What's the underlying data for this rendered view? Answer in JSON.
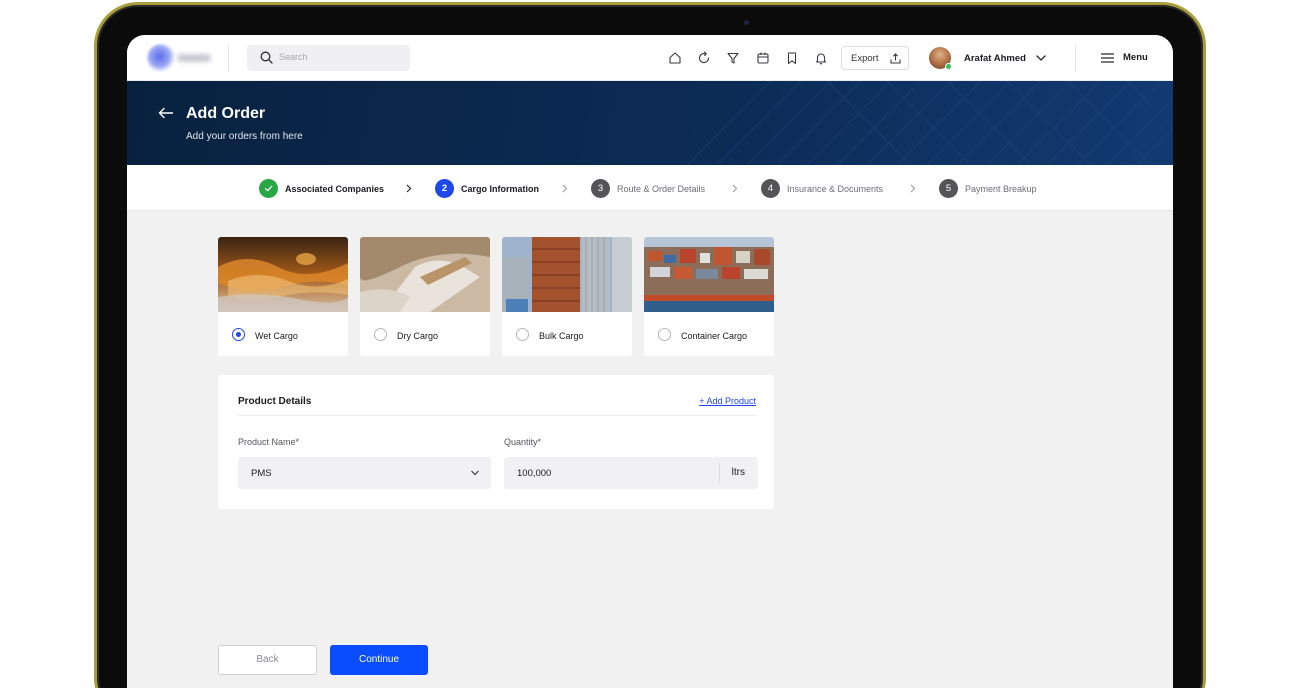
{
  "topbar": {
    "search_placeholder": "Search",
    "export_label": "Export",
    "user_name": "Arafat Ahmed",
    "menu_label": "Menu",
    "icons": [
      "home-icon",
      "refresh-icon",
      "filter-icon",
      "calendar-icon",
      "bookmark-icon",
      "bell-icon"
    ]
  },
  "hero": {
    "title": "Add Order",
    "subtitle": "Add your orders from here"
  },
  "stepper": {
    "steps": [
      {
        "number": "1",
        "label": "Associated Companies",
        "state": "done"
      },
      {
        "number": "2",
        "label": "Cargo Information",
        "state": "active"
      },
      {
        "number": "3",
        "label": "Route & Order Details",
        "state": "pending"
      },
      {
        "number": "4",
        "label": "Insurance & Documents",
        "state": "pending"
      },
      {
        "number": "5",
        "label": "Payment Breakup",
        "state": "pending"
      }
    ]
  },
  "cargo_options": [
    {
      "label": "Wet Cargo",
      "selected": true
    },
    {
      "label": "Dry Cargo",
      "selected": false
    },
    {
      "label": "Bulk Cargo",
      "selected": false
    },
    {
      "label": "Container Cargo",
      "selected": false
    }
  ],
  "product_details": {
    "title": "Product Details",
    "add_product_label": "+ Add Product",
    "product_name_label": "Product Name*",
    "product_name_value": "PMS",
    "quantity_label": "Quantity*",
    "quantity_value": "100,000",
    "quantity_unit": "ltrs"
  },
  "actions": {
    "back_label": "Back",
    "continue_label": "Continue"
  },
  "colors": {
    "accent": "#1f48e8",
    "primary_button": "#0a4dff",
    "done_step": "#28a745",
    "hero_bg": "#0c2b55"
  }
}
